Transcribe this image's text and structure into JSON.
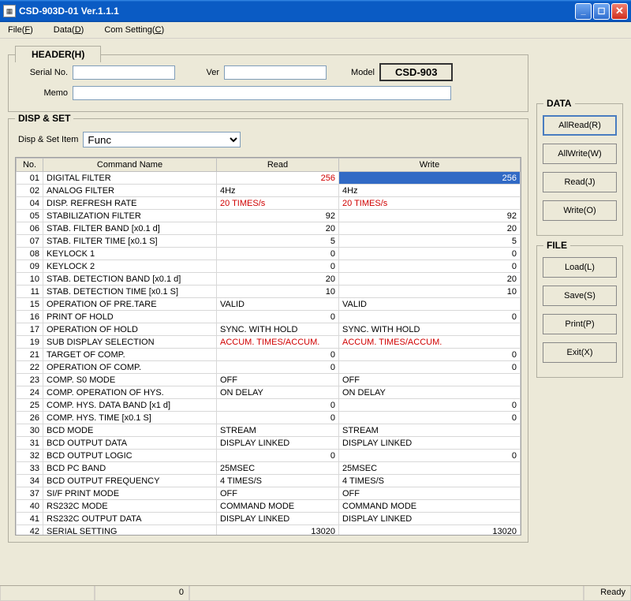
{
  "window": {
    "title": "CSD-903D-01 Ver.1.1.1"
  },
  "menus": {
    "file": {
      "pre": "File(",
      "key": "F",
      "post": ")"
    },
    "data": {
      "pre": "Data(",
      "key": "D",
      "post": ")"
    },
    "comsetting": {
      "pre": "Com Setting(",
      "key": "C",
      "post": ")"
    }
  },
  "header": {
    "tab": "HEADER(H)",
    "serial_label": "Serial No.",
    "serial_value": "",
    "ver_label": "Ver",
    "ver_value": "",
    "model_label": "Model",
    "model_value": "CSD-903",
    "memo_label": "Memo",
    "memo_value": ""
  },
  "dispset": {
    "title": "DISP & SET",
    "item_label": "Disp & Set Item",
    "item_value": "Func",
    "cols": {
      "no": "No.",
      "cmd": "Command Name",
      "read": "Read",
      "write": "Write"
    },
    "rows": [
      {
        "no": "01",
        "cmd": "DIGITAL FILTER",
        "read": "256",
        "write": "256",
        "numlike": true,
        "red": true,
        "selected": true
      },
      {
        "no": "02",
        "cmd": "ANALOG FILTER",
        "read": "4Hz",
        "write": "4Hz"
      },
      {
        "no": "04",
        "cmd": "DISP. REFRESH RATE",
        "read": "20 TIMES/s",
        "write": "20 TIMES/s",
        "red": true
      },
      {
        "no": "05",
        "cmd": "STABILIZATION FILTER",
        "read": "92",
        "write": "92",
        "numlike": true
      },
      {
        "no": "06",
        "cmd": "STAB. FILTER BAND [x0.1 d]",
        "read": "20",
        "write": "20",
        "numlike": true
      },
      {
        "no": "07",
        "cmd": "STAB. FILTER TIME [x0.1 S]",
        "read": "5",
        "write": "5",
        "numlike": true
      },
      {
        "no": "08",
        "cmd": "KEYLOCK 1",
        "read": "0",
        "write": "0",
        "numlike": true
      },
      {
        "no": "09",
        "cmd": "KEYLOCK 2",
        "read": "0",
        "write": "0",
        "numlike": true
      },
      {
        "no": "10",
        "cmd": "STAB. DETECTION BAND [x0.1 d]",
        "read": "20",
        "write": "20",
        "numlike": true
      },
      {
        "no": "11",
        "cmd": "STAB. DETECTION TIME [x0.1 S]",
        "read": "10",
        "write": "10",
        "numlike": true
      },
      {
        "no": "15",
        "cmd": "OPERATION OF PRE.TARE",
        "read": "VALID",
        "write": "VALID"
      },
      {
        "no": "16",
        "cmd": "PRINT OF HOLD",
        "read": "0",
        "write": "0",
        "numlike": true
      },
      {
        "no": "17",
        "cmd": "OPERATION OF HOLD",
        "read": "SYNC. WITH HOLD",
        "write": "SYNC. WITH HOLD"
      },
      {
        "no": "19",
        "cmd": "SUB DISPLAY SELECTION",
        "read": "ACCUM. TIMES/ACCUM.",
        "write": "ACCUM. TIMES/ACCUM.",
        "red": true
      },
      {
        "no": "21",
        "cmd": "TARGET OF COMP.",
        "read": "0",
        "write": "0",
        "numlike": true
      },
      {
        "no": "22",
        "cmd": "OPERATION OF COMP.",
        "read": "0",
        "write": "0",
        "numlike": true
      },
      {
        "no": "23",
        "cmd": "COMP. S0 MODE",
        "read": "OFF",
        "write": "OFF"
      },
      {
        "no": "24",
        "cmd": "COMP. OPERATION OF HYS.",
        "read": "ON DELAY",
        "write": "ON DELAY"
      },
      {
        "no": "25",
        "cmd": "COMP. HYS. DATA BAND [x1 d]",
        "read": "0",
        "write": "0",
        "numlike": true
      },
      {
        "no": "26",
        "cmd": "COMP. HYS. TIME [x0.1 S]",
        "read": "0",
        "write": "0",
        "numlike": true
      },
      {
        "no": "30",
        "cmd": "BCD MODE",
        "read": "STREAM",
        "write": "STREAM"
      },
      {
        "no": "31",
        "cmd": "BCD OUTPUT DATA",
        "read": "DISPLAY LINKED",
        "write": "DISPLAY LINKED"
      },
      {
        "no": "32",
        "cmd": "BCD OUTPUT LOGIC",
        "read": "0",
        "write": "0",
        "numlike": true
      },
      {
        "no": "33",
        "cmd": "BCD PC BAND",
        "read": "25MSEC",
        "write": "25MSEC"
      },
      {
        "no": "34",
        "cmd": "BCD OUTPUT FREQUENCY",
        "read": "4 TIMES/S",
        "write": "4 TIMES/S"
      },
      {
        "no": "37",
        "cmd": "SI/F PRINT MODE",
        "read": "OFF",
        "write": "OFF"
      },
      {
        "no": "40",
        "cmd": "RS232C MODE",
        "read": "COMMAND MODE",
        "write": "COMMAND MODE"
      },
      {
        "no": "41",
        "cmd": "RS232C OUTPUT DATA",
        "read": "DISPLAY LINKED",
        "write": "DISPLAY LINKED"
      },
      {
        "no": "42",
        "cmd": "SERIAL SETTING",
        "read": "13020",
        "write": "13020",
        "numlike": true
      }
    ]
  },
  "data_panel": {
    "title": "DATA",
    "allread": "AllRead(R)",
    "allwrite": "AllWrite(W)",
    "read": "Read(J)",
    "write": "Write(O)"
  },
  "file_panel": {
    "title": "FILE",
    "load": "Load(L)",
    "save": "Save(S)",
    "print": "Print(P)",
    "exit": "Exit(X)"
  },
  "statusbar": {
    "val": "0",
    "ready": "Ready"
  }
}
